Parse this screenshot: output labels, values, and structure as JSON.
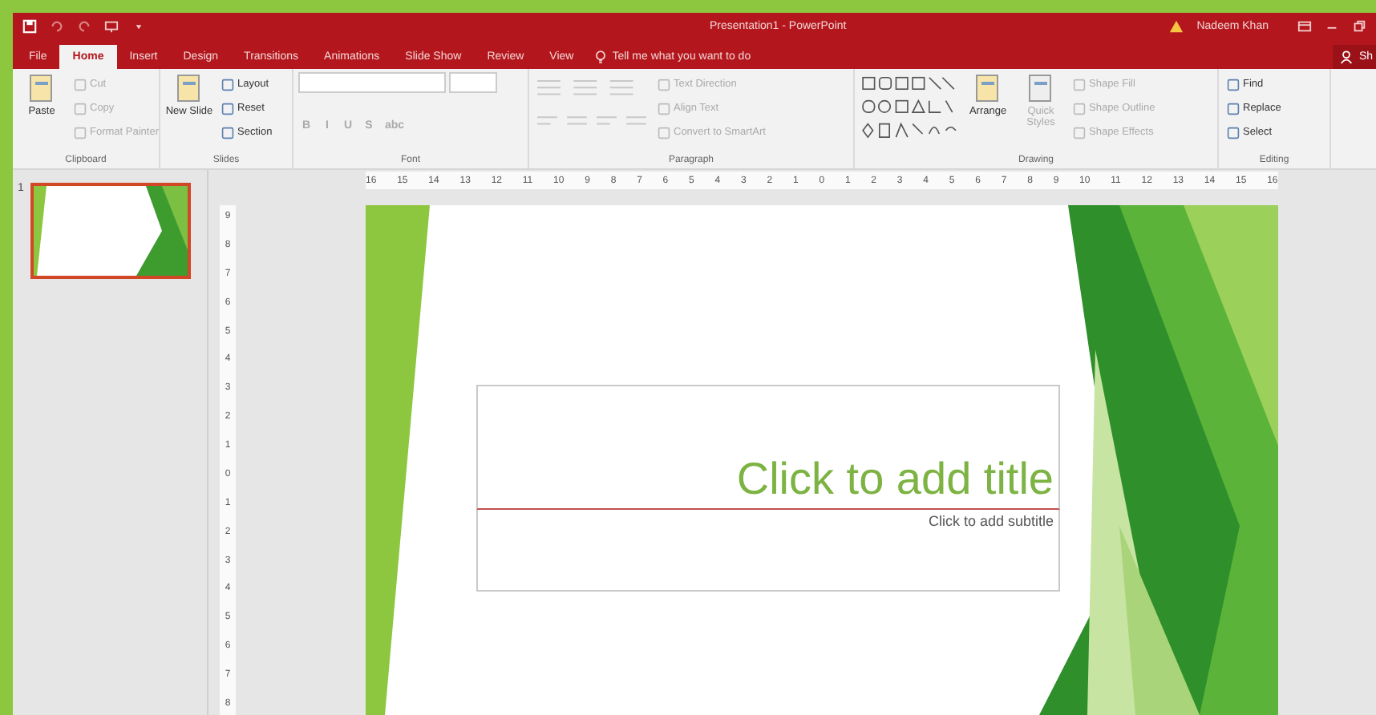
{
  "window": {
    "title": "Presentation1 - PowerPoint",
    "user": "Nadeem Khan"
  },
  "tabs": [
    {
      "label": "File",
      "selected": false
    },
    {
      "label": "Home",
      "selected": true
    },
    {
      "label": "Insert",
      "selected": false
    },
    {
      "label": "Design",
      "selected": false
    },
    {
      "label": "Transitions",
      "selected": false
    },
    {
      "label": "Animations",
      "selected": false
    },
    {
      "label": "Slide Show",
      "selected": false
    },
    {
      "label": "Review",
      "selected": false
    },
    {
      "label": "View",
      "selected": false
    }
  ],
  "tell_me": {
    "placeholder": "Tell me what you want to do"
  },
  "share": "Sh",
  "ribbon": [
    {
      "label": "Clipboard",
      "items": [
        {
          "kind": "large",
          "label": "Paste",
          "disabled": false
        },
        {
          "kind": "small",
          "label": "Cut",
          "disabled": true
        },
        {
          "kind": "small",
          "label": "Copy",
          "disabled": true
        },
        {
          "kind": "small",
          "label": "Format Painter",
          "disabled": true
        }
      ]
    },
    {
      "label": "Slides",
      "items": [
        {
          "kind": "large",
          "label": "New Slide",
          "disabled": false
        },
        {
          "kind": "small",
          "label": "Layout",
          "disabled": false
        },
        {
          "kind": "small",
          "label": "Reset",
          "disabled": false
        },
        {
          "kind": "small",
          "label": "Section",
          "disabled": false
        }
      ]
    },
    {
      "label": "Font",
      "items": [
        {
          "kind": "field"
        },
        {
          "kind": "format",
          "label": "B",
          "disabled": true
        },
        {
          "kind": "format",
          "label": "I",
          "disabled": true
        },
        {
          "kind": "format",
          "label": "U",
          "disabled": true
        },
        {
          "kind": "format",
          "label": "S",
          "disabled": true
        },
        {
          "kind": "format",
          "label": "abc",
          "disabled": true
        }
      ]
    },
    {
      "label": "Paragraph",
      "items": [
        {
          "kind": "lines",
          "disabled": true
        },
        {
          "kind": "small",
          "label": "Text Direction",
          "disabled": true
        },
        {
          "kind": "small",
          "label": "Align Text",
          "disabled": true
        },
        {
          "kind": "small",
          "label": "Convert to SmartArt",
          "disabled": true
        }
      ]
    },
    {
      "label": "Drawing",
      "items": [
        {
          "kind": "gallery"
        },
        {
          "kind": "large",
          "label": "Arrange",
          "disabled": false
        },
        {
          "kind": "large",
          "label": "Quick Styles",
          "disabled": true
        },
        {
          "kind": "small",
          "label": "Shape Fill",
          "disabled": true
        },
        {
          "kind": "small",
          "label": "Shape Outline",
          "disabled": true
        },
        {
          "kind": "small",
          "label": "Shape Effects",
          "disabled": true
        }
      ]
    },
    {
      "label": "Editing",
      "items": [
        {
          "kind": "small",
          "label": "Find",
          "disabled": false
        },
        {
          "kind": "small",
          "label": "Replace",
          "disabled": false
        },
        {
          "kind": "small",
          "label": "Select",
          "disabled": false
        }
      ]
    }
  ],
  "ruler": {
    "horizontal": [
      "16",
      "15",
      "14",
      "13",
      "12",
      "11",
      "10",
      "9",
      "8",
      "7",
      "6",
      "5",
      "4",
      "3",
      "2",
      "1",
      "0",
      "1",
      "2",
      "3",
      "4",
      "5",
      "6",
      "7",
      "8",
      "9",
      "10",
      "11",
      "12",
      "13",
      "14",
      "15",
      "16"
    ],
    "vertical": [
      "9",
      "8",
      "7",
      "6",
      "5",
      "4",
      "3",
      "2",
      "1",
      "0",
      "1",
      "2",
      "3",
      "4",
      "5",
      "6",
      "7",
      "8"
    ]
  },
  "thumbnails": [
    {
      "number": "1",
      "selected": true
    }
  ],
  "slide": {
    "title": "Click to add title",
    "subtitle": "Click to add subtitle"
  }
}
